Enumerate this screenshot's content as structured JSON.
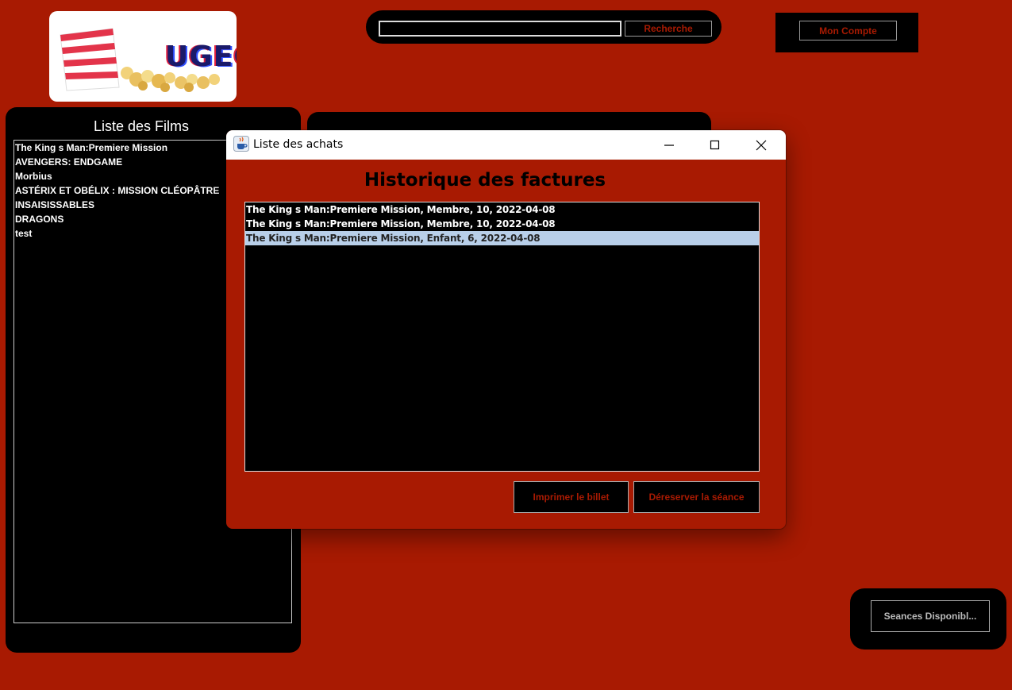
{
  "logo": {
    "text": "UGECE"
  },
  "search": {
    "value": "",
    "button_label": "Recherche"
  },
  "account": {
    "button_label": "Mon Compte"
  },
  "films": {
    "title": "Liste des Films",
    "items": [
      "The King s Man:Premiere Mission",
      "AVENGERS: ENDGAME",
      "Morbius",
      "ASTÉRIX ET OBÉLIX : MISSION CLÉOPÂTRE",
      "INSAISISSABLES",
      "DRAGONS",
      "test"
    ]
  },
  "seances": {
    "button_label": "Seances Disponibl..."
  },
  "dialog": {
    "window_title": "Liste des achats",
    "heading": "Historique des factures",
    "invoices": [
      "The King s Man:Premiere Mission, Membre, 10, 2022-04-08",
      "The King s Man:Premiere Mission, Membre, 10, 2022-04-08",
      "The King s Man:Premiere Mission, Enfant, 6, 2022-04-08"
    ],
    "selected_index": 2,
    "print_label": "Imprimer le billet",
    "unreserve_label": "Déreserver la séance"
  },
  "colors": {
    "background": "#a81a02",
    "panel": "#000000",
    "selection": "#b8cfe9",
    "button_text": "#a81a02"
  },
  "icons": {
    "app": "java-cup-icon",
    "minimize": "minimize-icon",
    "maximize": "maximize-icon",
    "close": "close-icon"
  }
}
